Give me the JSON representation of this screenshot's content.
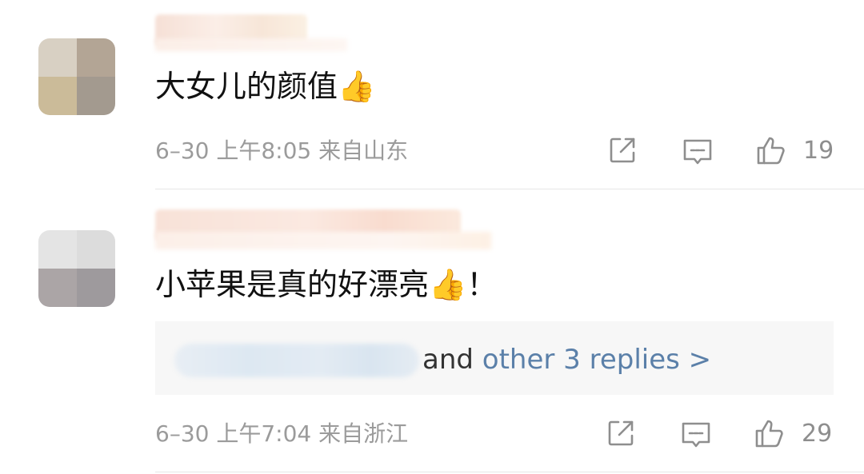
{
  "comments": [
    {
      "text": "大女儿的颜值👍",
      "date": "6–30",
      "time": "上午8:05",
      "location": "来自山东",
      "likes": "19"
    },
    {
      "text": "小苹果是真的好漂亮👍！",
      "date": "6–30",
      "time": "上午7:04",
      "location": "来自浙江",
      "likes": "29",
      "replies": {
        "and": "and",
        "link": "other 3 replies >"
      }
    }
  ],
  "icons": [
    "share-icon",
    "comment-icon",
    "like-icon"
  ],
  "colors": {
    "meta_gray": "#9b9b9b",
    "link_blue": "#5b80a9",
    "reply_bg": "#f7f7f7"
  }
}
